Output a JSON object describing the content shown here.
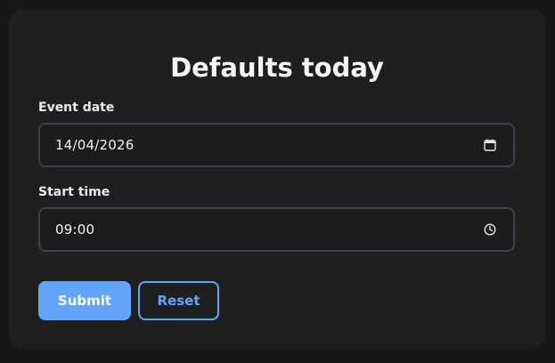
{
  "form": {
    "title": "Defaults today",
    "event_date": {
      "label": "Event date",
      "value": "14/04/2026",
      "icon": "calendar-icon"
    },
    "start_time": {
      "label": "Start time",
      "value": "09:00",
      "icon": "clock-icon"
    },
    "buttons": {
      "submit_label": "Submit",
      "reset_label": "Reset"
    }
  },
  "colors": {
    "background": "#171717",
    "card": "#1f1f1f",
    "field_border": "#3b4250",
    "accent": "#60a5fa",
    "text": "#f3f4f6"
  }
}
